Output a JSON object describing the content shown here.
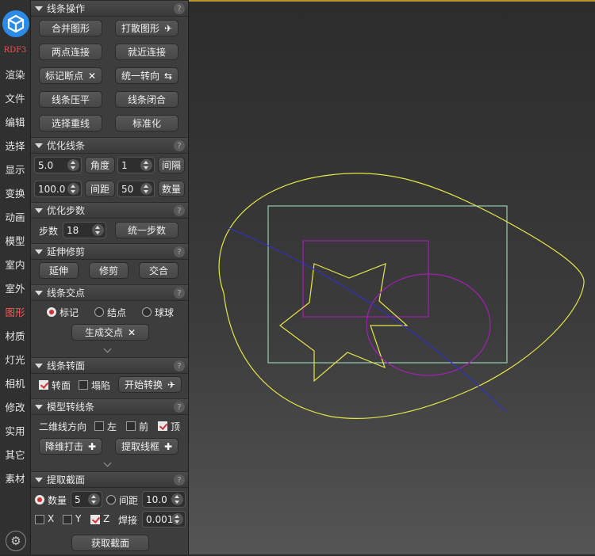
{
  "nav": {
    "logo": "app-logo",
    "version": "RDF3",
    "items": [
      "渲染",
      "文件",
      "编辑",
      "选择",
      "显示",
      "变换",
      "动画",
      "模型",
      "室内",
      "室外",
      "图形",
      "材质",
      "灯光",
      "相机",
      "修改",
      "实用",
      "其它",
      "素材"
    ],
    "active": "图形"
  },
  "sections": {
    "line_ops": {
      "title": "线条操作",
      "buttons": [
        "合并图形",
        "打散图形",
        "两点连接",
        "就近连接",
        "标记断点",
        "统一转向",
        "线条压平",
        "线条闭合",
        "选择重线",
        "标准化"
      ]
    },
    "optimize_line": {
      "title": "优化线条",
      "angle_value": "5.0",
      "angle_label": "角度",
      "interval_value": "1",
      "interval_label": "间隔",
      "spacing_value": "100.0",
      "spacing_label": "间距",
      "count_value": "50",
      "count_label": "数量"
    },
    "optimize_steps": {
      "title": "优化步数",
      "steps_label": "步数",
      "steps_value": "18",
      "unify_label": "统一步数"
    },
    "extend_trim": {
      "title": "延伸修剪",
      "buttons": [
        "延伸",
        "修剪",
        "交合"
      ]
    },
    "intersections": {
      "title": "线条交点",
      "options": [
        "标记",
        "结点",
        "球球"
      ],
      "selected": "标记",
      "generate_label": "生成交点"
    },
    "line_to_face": {
      "title": "线条转面",
      "face_label": "转面",
      "face_checked": true,
      "collapse_label": "塌陷",
      "collapse_checked": false,
      "start_label": "开始转换"
    },
    "model_to_line": {
      "title": "模型转线条",
      "direction_label": "二维线方向",
      "left_label": "左",
      "left_checked": false,
      "front_label": "前",
      "front_checked": false,
      "top_label": "顶",
      "top_checked": true,
      "reduce_label": "降维打击",
      "extract_label": "提取线框"
    },
    "extract_section": {
      "title": "提取截面",
      "count_label": "数量",
      "count_value": "5",
      "count_selected": true,
      "spacing_label": "间距",
      "spacing_value": "10.0",
      "x_label": "X",
      "x_checked": false,
      "y_label": "Y",
      "y_checked": false,
      "z_label": "Z",
      "z_checked": true,
      "weld_label": "焊接",
      "weld_value": "0.001",
      "get_label": "获取截面"
    }
  },
  "help_icon": "?",
  "viewport": {
    "shapes": [
      "ellipse-egg",
      "rectangle",
      "rectangle",
      "star",
      "circle",
      "line"
    ],
    "colors": {
      "yellow": "#e6e64a",
      "cyan": "#a8e8c8",
      "purple": "#a020b0",
      "blue": "#3030c0",
      "accent": "#b8962e"
    }
  }
}
